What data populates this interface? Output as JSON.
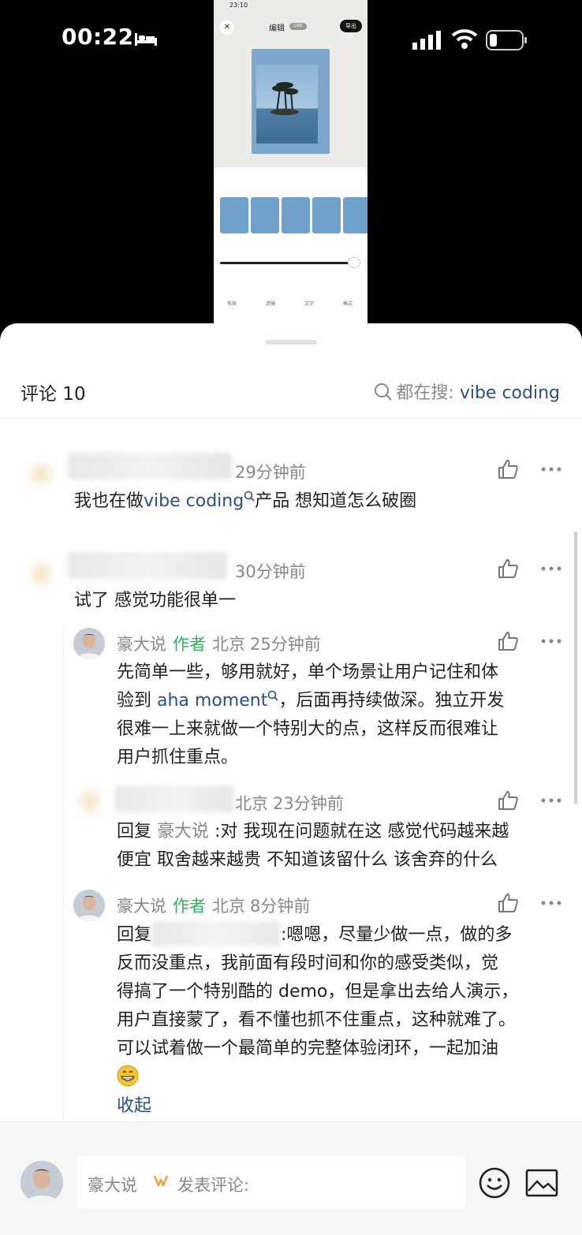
{
  "status_bar": {
    "time": "00:22"
  },
  "embedded_screenshot": {
    "time": "23:10",
    "title": "编辑",
    "live_badge": "LIVE",
    "export_label": "导出",
    "tabs": [
      "布局",
      "滤镜",
      "文字",
      "格式"
    ]
  },
  "comments_header": {
    "title": "评论 10",
    "search_prefix": "都在搜:",
    "search_keyword": "vibe coding"
  },
  "comments": [
    {
      "time": "29分钟前",
      "text_before": "我也在做",
      "link": "vibe coding",
      "text_after": "产品 想知道怎么破圈"
    },
    {
      "time": "30分钟前",
      "text": "试了 感觉功能很单一",
      "replies": [
        {
          "name": "豪大说",
          "author_tag": "作者",
          "location": "北京",
          "time": "25分钟前",
          "line1": "先简单一些，够用就好，单个场景让用户记住和体",
          "line2_before": "验到 ",
          "line2_link": "aha moment",
          "line2_after": "，后面再持续做深。独立开发",
          "line3": "很难一上来就做一个特别大的点，这样反而很难让",
          "line4": "用户抓住重点。"
        },
        {
          "location": "北京",
          "time": "23分钟前",
          "reply_prefix": "回复",
          "reply_to": "豪大说",
          "line1": ":对 我现在问题就在这 感觉代码越来越",
          "line2": "便宜 取舍越来越贵 不知道该留什么 该舍弃的什么"
        },
        {
          "name": "豪大说",
          "author_tag": "作者",
          "location": "北京",
          "time": "8分钟前",
          "reply_prefix": "回复",
          "line1": ":嗯嗯，尽量少做一点，做的多",
          "line2": "反而没重点，我前面有段时间和你的感受类似，觉",
          "line3": "得搞了一个特别酷的 demo，但是拿出去给人演示，",
          "line4": "用户直接蒙了，看不懂也抓不住重点，这种就难了。",
          "line5": "可以试着做一个最简单的完整体验闭环，一起加油"
        }
      ],
      "collapse_label": "收起"
    }
  ],
  "composer": {
    "username": "豪大说",
    "placeholder": "发表评论:"
  },
  "colors": {
    "link": "#2b4f83",
    "author_tag": "#2db55d",
    "meta": "#888888"
  },
  "icons": [
    "bed-icon",
    "signal-icon",
    "wifi-icon",
    "battery-icon",
    "search-icon",
    "like-icon",
    "more-icon",
    "emoji-icon",
    "image-icon"
  ]
}
